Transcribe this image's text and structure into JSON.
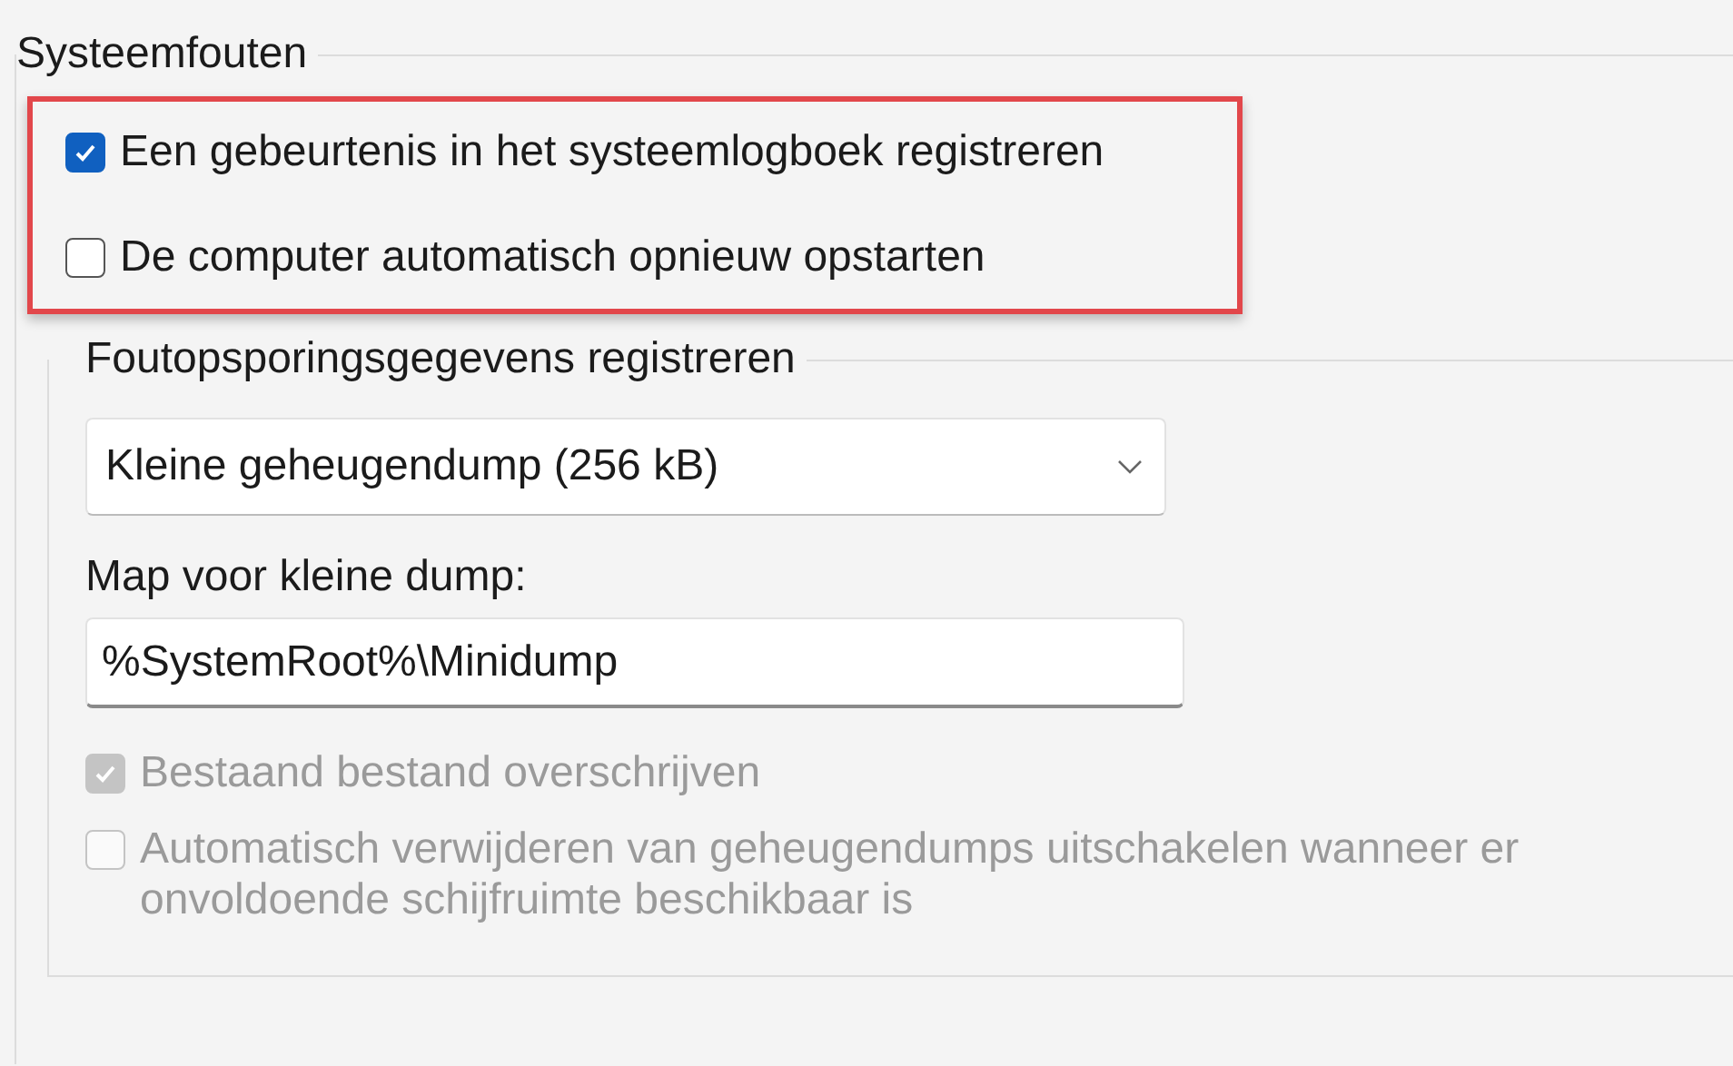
{
  "group": {
    "title": "Systeemfouten",
    "options_highlighted": true,
    "options": [
      {
        "label": "Een gebeurtenis in het systeemlogboek registreren",
        "checked": true
      },
      {
        "label": "De computer automatisch opnieuw opstarten",
        "checked": false
      }
    ]
  },
  "debug": {
    "title": "Foutopsporingsgegevens registreren",
    "dump_type": {
      "value": "Kleine geheugendump (256 kB)"
    },
    "folder_label": "Map voor kleine dump:",
    "folder": {
      "value": "%SystemRoot%\\Minidump"
    },
    "options": [
      {
        "label": "Bestaand bestand overschrijven",
        "checked": true,
        "disabled": true
      },
      {
        "label": "Automatisch verwijderen van geheugendumps uitschakelen wanneer er onvoldoende schijfruimte beschikbaar is",
        "checked": false,
        "disabled": true
      }
    ]
  }
}
